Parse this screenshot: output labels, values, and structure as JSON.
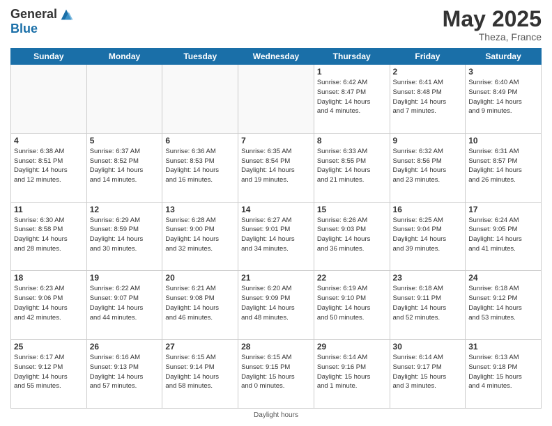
{
  "logo": {
    "general": "General",
    "blue": "Blue"
  },
  "header": {
    "month_year": "May 2025",
    "location": "Theza, France"
  },
  "days_of_week": [
    "Sunday",
    "Monday",
    "Tuesday",
    "Wednesday",
    "Thursday",
    "Friday",
    "Saturday"
  ],
  "footer": {
    "daylight_label": "Daylight hours"
  },
  "weeks": [
    [
      {
        "day": "",
        "info": ""
      },
      {
        "day": "",
        "info": ""
      },
      {
        "day": "",
        "info": ""
      },
      {
        "day": "",
        "info": ""
      },
      {
        "day": "1",
        "info": "Sunrise: 6:42 AM\nSunset: 8:47 PM\nDaylight: 14 hours\nand 4 minutes."
      },
      {
        "day": "2",
        "info": "Sunrise: 6:41 AM\nSunset: 8:48 PM\nDaylight: 14 hours\nand 7 minutes."
      },
      {
        "day": "3",
        "info": "Sunrise: 6:40 AM\nSunset: 8:49 PM\nDaylight: 14 hours\nand 9 minutes."
      }
    ],
    [
      {
        "day": "4",
        "info": "Sunrise: 6:38 AM\nSunset: 8:51 PM\nDaylight: 14 hours\nand 12 minutes."
      },
      {
        "day": "5",
        "info": "Sunrise: 6:37 AM\nSunset: 8:52 PM\nDaylight: 14 hours\nand 14 minutes."
      },
      {
        "day": "6",
        "info": "Sunrise: 6:36 AM\nSunset: 8:53 PM\nDaylight: 14 hours\nand 16 minutes."
      },
      {
        "day": "7",
        "info": "Sunrise: 6:35 AM\nSunset: 8:54 PM\nDaylight: 14 hours\nand 19 minutes."
      },
      {
        "day": "8",
        "info": "Sunrise: 6:33 AM\nSunset: 8:55 PM\nDaylight: 14 hours\nand 21 minutes."
      },
      {
        "day": "9",
        "info": "Sunrise: 6:32 AM\nSunset: 8:56 PM\nDaylight: 14 hours\nand 23 minutes."
      },
      {
        "day": "10",
        "info": "Sunrise: 6:31 AM\nSunset: 8:57 PM\nDaylight: 14 hours\nand 26 minutes."
      }
    ],
    [
      {
        "day": "11",
        "info": "Sunrise: 6:30 AM\nSunset: 8:58 PM\nDaylight: 14 hours\nand 28 minutes."
      },
      {
        "day": "12",
        "info": "Sunrise: 6:29 AM\nSunset: 8:59 PM\nDaylight: 14 hours\nand 30 minutes."
      },
      {
        "day": "13",
        "info": "Sunrise: 6:28 AM\nSunset: 9:00 PM\nDaylight: 14 hours\nand 32 minutes."
      },
      {
        "day": "14",
        "info": "Sunrise: 6:27 AM\nSunset: 9:01 PM\nDaylight: 14 hours\nand 34 minutes."
      },
      {
        "day": "15",
        "info": "Sunrise: 6:26 AM\nSunset: 9:03 PM\nDaylight: 14 hours\nand 36 minutes."
      },
      {
        "day": "16",
        "info": "Sunrise: 6:25 AM\nSunset: 9:04 PM\nDaylight: 14 hours\nand 39 minutes."
      },
      {
        "day": "17",
        "info": "Sunrise: 6:24 AM\nSunset: 9:05 PM\nDaylight: 14 hours\nand 41 minutes."
      }
    ],
    [
      {
        "day": "18",
        "info": "Sunrise: 6:23 AM\nSunset: 9:06 PM\nDaylight: 14 hours\nand 42 minutes."
      },
      {
        "day": "19",
        "info": "Sunrise: 6:22 AM\nSunset: 9:07 PM\nDaylight: 14 hours\nand 44 minutes."
      },
      {
        "day": "20",
        "info": "Sunrise: 6:21 AM\nSunset: 9:08 PM\nDaylight: 14 hours\nand 46 minutes."
      },
      {
        "day": "21",
        "info": "Sunrise: 6:20 AM\nSunset: 9:09 PM\nDaylight: 14 hours\nand 48 minutes."
      },
      {
        "day": "22",
        "info": "Sunrise: 6:19 AM\nSunset: 9:10 PM\nDaylight: 14 hours\nand 50 minutes."
      },
      {
        "day": "23",
        "info": "Sunrise: 6:18 AM\nSunset: 9:11 PM\nDaylight: 14 hours\nand 52 minutes."
      },
      {
        "day": "24",
        "info": "Sunrise: 6:18 AM\nSunset: 9:12 PM\nDaylight: 14 hours\nand 53 minutes."
      }
    ],
    [
      {
        "day": "25",
        "info": "Sunrise: 6:17 AM\nSunset: 9:12 PM\nDaylight: 14 hours\nand 55 minutes."
      },
      {
        "day": "26",
        "info": "Sunrise: 6:16 AM\nSunset: 9:13 PM\nDaylight: 14 hours\nand 57 minutes."
      },
      {
        "day": "27",
        "info": "Sunrise: 6:15 AM\nSunset: 9:14 PM\nDaylight: 14 hours\nand 58 minutes."
      },
      {
        "day": "28",
        "info": "Sunrise: 6:15 AM\nSunset: 9:15 PM\nDaylight: 15 hours\nand 0 minutes."
      },
      {
        "day": "29",
        "info": "Sunrise: 6:14 AM\nSunset: 9:16 PM\nDaylight: 15 hours\nand 1 minute."
      },
      {
        "day": "30",
        "info": "Sunrise: 6:14 AM\nSunset: 9:17 PM\nDaylight: 15 hours\nand 3 minutes."
      },
      {
        "day": "31",
        "info": "Sunrise: 6:13 AM\nSunset: 9:18 PM\nDaylight: 15 hours\nand 4 minutes."
      }
    ]
  ]
}
